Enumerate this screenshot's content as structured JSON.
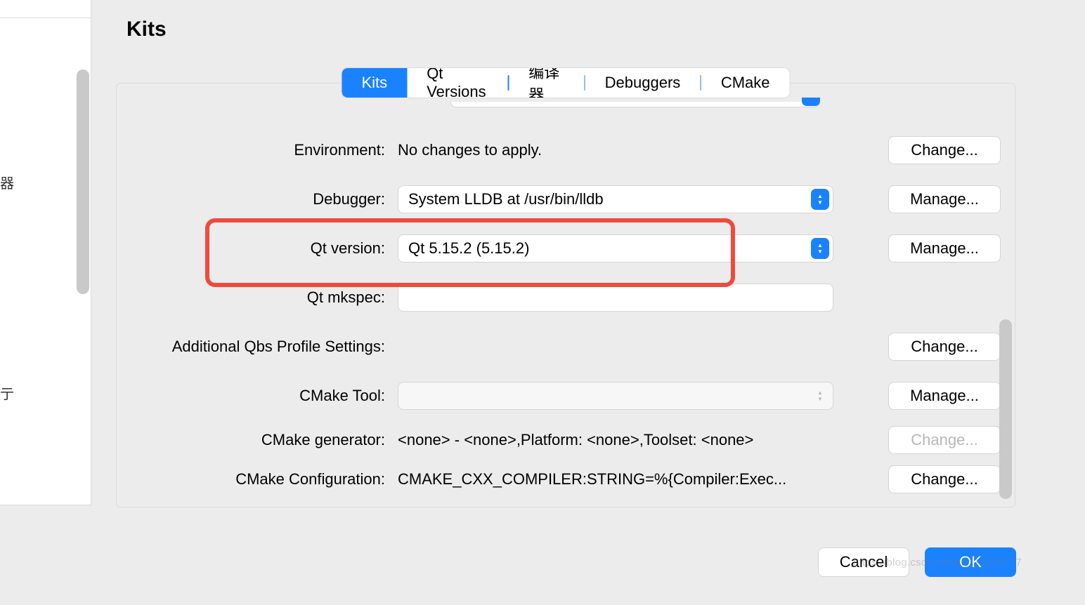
{
  "title": "Kits",
  "tabs": {
    "kits": "Kits",
    "qt_versions": "Qt Versions",
    "compilers": "编译器",
    "debuggers": "Debuggers",
    "cmake": "CMake"
  },
  "rows": {
    "environment": {
      "label": "Environment:",
      "value": "No changes to apply.",
      "button": "Change..."
    },
    "debugger": {
      "label": "Debugger:",
      "value": "System LLDB at /usr/bin/lldb",
      "button": "Manage..."
    },
    "qt_version": {
      "label": "Qt version:",
      "value": "Qt 5.15.2 (5.15.2)",
      "button": "Manage..."
    },
    "qt_mkspec": {
      "label": "Qt mkspec:",
      "value": ""
    },
    "qbs": {
      "label": "Additional Qbs Profile Settings:",
      "button": "Change..."
    },
    "cmake_tool": {
      "label": "CMake Tool:",
      "value": "",
      "button": "Manage..."
    },
    "cmake_gen": {
      "label": "CMake generator:",
      "value": "<none> - <none>,Platform: <none>,Toolset: <none>",
      "button": "Change..."
    },
    "cmake_cfg": {
      "label": "CMake Configuration:",
      "value": "CMAKE_CXX_COMPILER:STRING=%{Compiler:Exec...",
      "button": "Change..."
    }
  },
  "sidebar": {
    "glyph1": "器",
    "glyph2": "亍"
  },
  "buttons": {
    "cancel": "Cancel",
    "ok": "OK"
  },
  "watermark": "https://blog.csdn.net/qq_25218777"
}
